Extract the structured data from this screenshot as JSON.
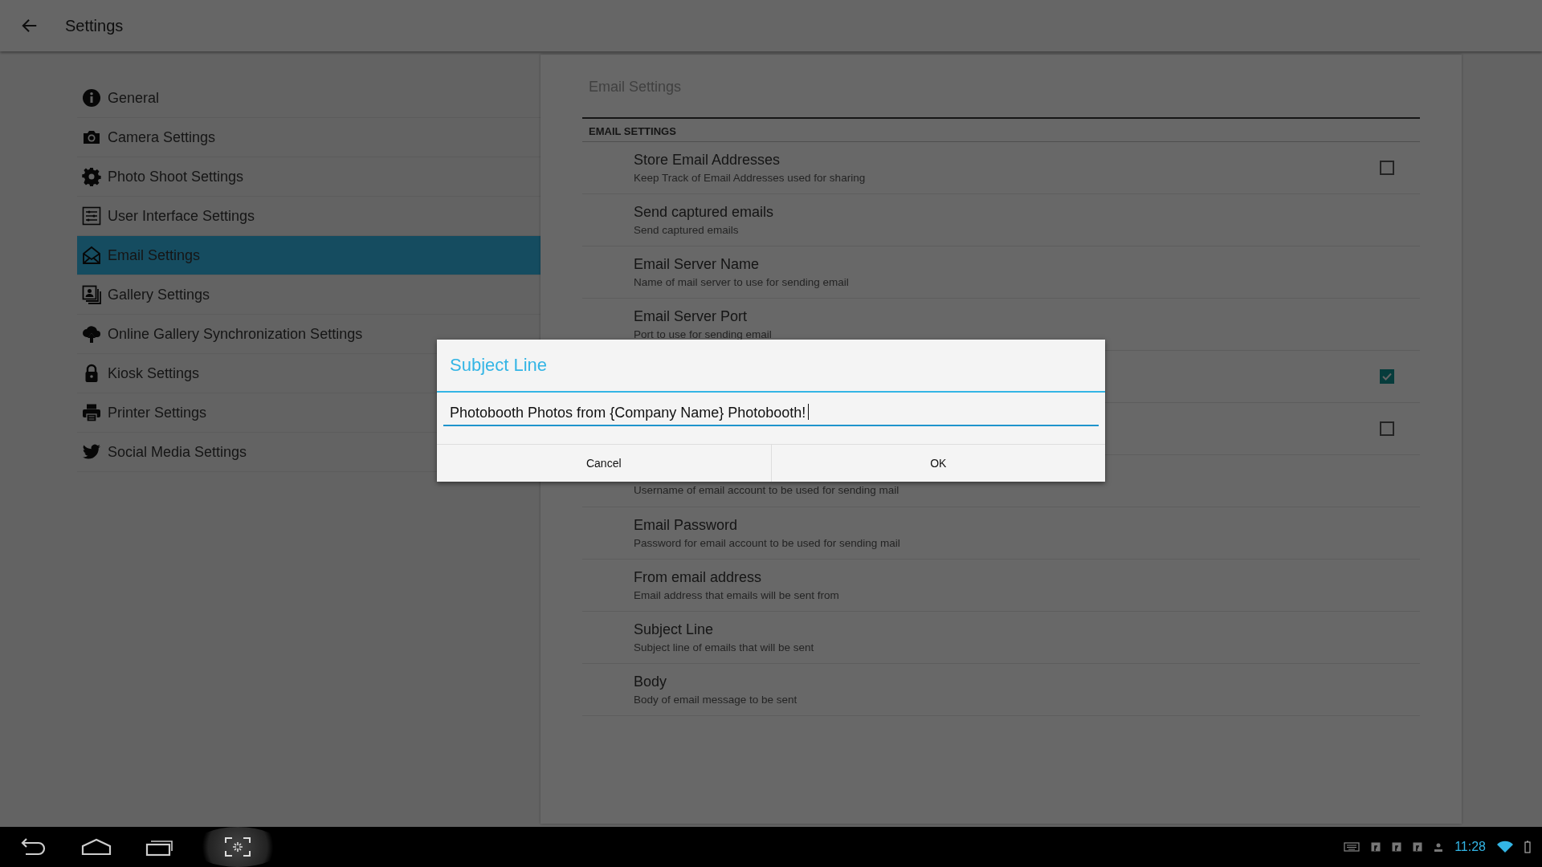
{
  "app_bar": {
    "title": "Settings"
  },
  "sidebar": {
    "items": [
      {
        "label": "General",
        "selected": false
      },
      {
        "label": "Camera Settings",
        "selected": false
      },
      {
        "label": "Photo Shoot Settings",
        "selected": false
      },
      {
        "label": "User Interface Settings",
        "selected": false
      },
      {
        "label": "Email Settings",
        "selected": true
      },
      {
        "label": "Gallery Settings",
        "selected": false
      },
      {
        "label": "Online Gallery Synchronization Settings",
        "selected": false
      },
      {
        "label": "Kiosk Settings",
        "selected": false
      },
      {
        "label": "Printer Settings",
        "selected": false
      },
      {
        "label": "Social Media Settings",
        "selected": false
      }
    ]
  },
  "panel": {
    "breadcrumb": "Email Settings",
    "section": "EMAIL SETTINGS",
    "rows": [
      {
        "kind": "checkbox",
        "title": "Store Email Addresses",
        "summary": "Keep Track of Email Addresses used for sharing",
        "checked": false
      },
      {
        "kind": "text",
        "title": "Send captured emails",
        "summary": "Send captured emails"
      },
      {
        "kind": "text",
        "title": "Email Server Name",
        "summary": "Name of mail server to use for sending email"
      },
      {
        "kind": "text",
        "title": "Email Server Port",
        "summary": "Port to use for sending email"
      },
      {
        "kind": "checkbox",
        "checked": true
      },
      {
        "kind": "checkbox",
        "checked": false
      },
      {
        "kind": "text",
        "summary": "Username of email account to be used for sending mail"
      },
      {
        "kind": "text",
        "title": "Email Password",
        "summary": "Password for email account to be used for sending mail"
      },
      {
        "kind": "text",
        "title": "From email address",
        "summary": "Email address that emails will be sent from"
      },
      {
        "kind": "text",
        "title": "Subject Line",
        "summary": "Subject line of emails that will be sent"
      },
      {
        "kind": "text",
        "title": "Body",
        "summary": "Body of email message to be sent"
      }
    ]
  },
  "dialog": {
    "title": "Subject Line",
    "value": "Photobooth Photos from {Company Name} Photobooth!",
    "buttons": [
      "Cancel",
      "OK"
    ]
  },
  "nav_bar": {
    "time": "11:28"
  }
}
